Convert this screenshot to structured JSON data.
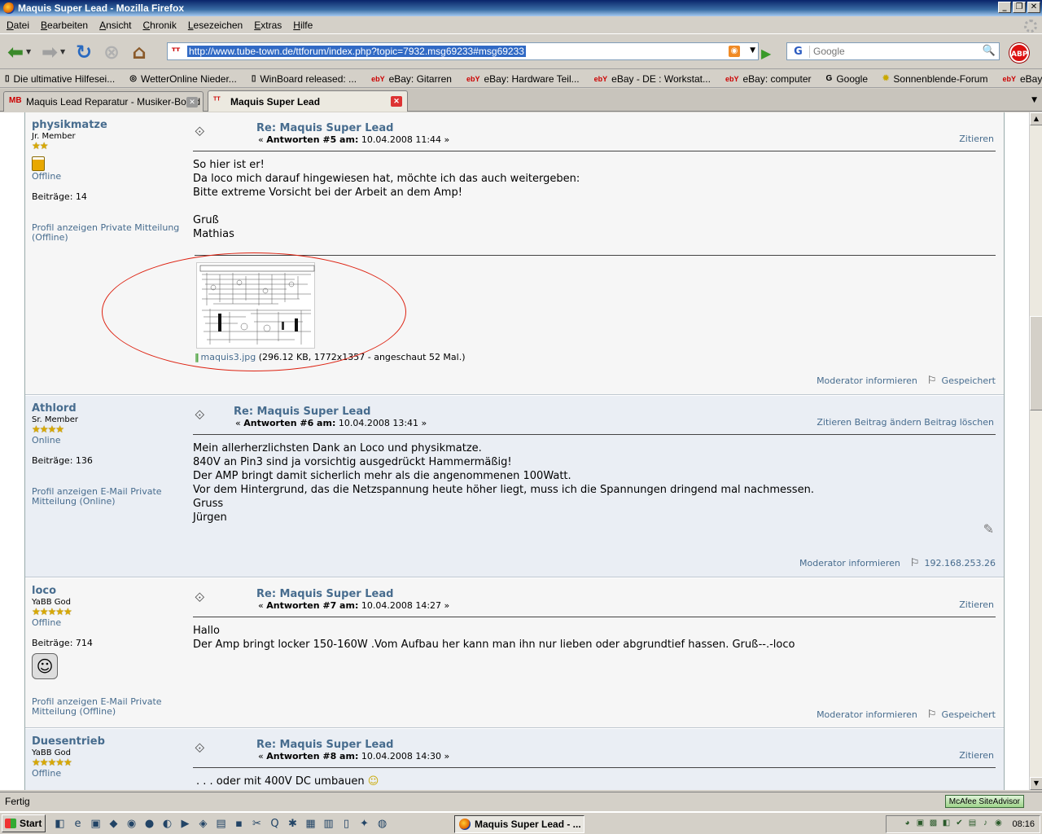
{
  "window": {
    "title": "Maquis Super Lead - Mozilla Firefox",
    "buttons": [
      "_",
      "❐",
      "✕"
    ]
  },
  "menu": [
    "Datei",
    "Bearbeiten",
    "Ansicht",
    "Chronik",
    "Lesezeichen",
    "Extras",
    "Hilfe"
  ],
  "nav": {
    "url": "http://www.tube-town.de/ttforum/index.php?topic=7932.msg69233#msg69233",
    "search_placeholder": "Google",
    "search_engine": "G",
    "abp": "ABP"
  },
  "bookmarks": [
    {
      "label": "Die ultimative Hilfesei...",
      "icon": "page-icon"
    },
    {
      "label": "WetterOnline Nieder...",
      "icon": "globe-icon"
    },
    {
      "label": "WinBoard released: ...",
      "icon": "page-icon"
    },
    {
      "label": "eBay: Gitarren",
      "icon": "ebay-icon"
    },
    {
      "label": "eBay: Hardware Teil...",
      "icon": "ebay-icon"
    },
    {
      "label": "eBay - DE : Workstat...",
      "icon": "ebay-icon"
    },
    {
      "label": "eBay: computer",
      "icon": "ebay-icon"
    },
    {
      "label": "Google",
      "icon": "google-icon"
    },
    {
      "label": "Sonnenblende-Forum",
      "icon": "sun-icon"
    },
    {
      "label": "eBay – Electric guitar...",
      "icon": "ebay-icon"
    }
  ],
  "tabs": [
    {
      "label": "Maquis Lead Reparatur - Musiker-Board",
      "close": "✕"
    },
    {
      "label": "Maquis Super Lead",
      "close": "✕"
    }
  ],
  "posts": [
    {
      "user": "physikmatze",
      "rank": "Jr. Member",
      "stars": "★★",
      "status": "Offline",
      "count": "Beiträge: 14",
      "links": "Profil anzeigen Private Mitteilung (Offline)",
      "title": "Re: Maquis Super Lead",
      "meta_prefix": "« ",
      "meta_bold": "Antworten #5 am:",
      "meta_date": " 10.04.2008 11:44 »",
      "actions": "Zitieren",
      "body": [
        "So hier ist er!",
        "Da loco mich darauf hingewiesen hat, möchte ich das auch weitergeben:",
        "Bitte extreme Vorsicht bei der Arbeit an dem Amp!",
        "",
        "Gruß",
        "Mathias"
      ],
      "attachment_name": "maquis3.jpg",
      "attachment_info": " (296.12 KB, 1772x1357 - angeschaut 52 Mal.)",
      "footer_left": "Moderator informieren",
      "footer_right": "Gespeichert"
    },
    {
      "user": "Athlord",
      "rank": "Sr. Member",
      "stars": "★★★★",
      "status": "Online",
      "count": "Beiträge: 136",
      "links": "Profil anzeigen E-Mail Private Mitteilung (Online)",
      "title": "Re: Maquis Super Lead",
      "meta_prefix": "« ",
      "meta_bold": "Antworten #6 am:",
      "meta_date": " 10.04.2008 13:41 »",
      "actions": "Zitieren Beitrag ändern Beitrag löschen",
      "body": [
        "Mein allerherzlichsten Dank an Loco und physikmatze.",
        "840V an Pin3 sind ja vorsichtig ausgedrückt Hammermäßig!",
        "Der AMP bringt damit sicherlich mehr als die angenommenen 100Watt.",
        "Vor dem Hintergrund, das die Netzspannung heute höher liegt, muss ich die Spannungen dringend mal nachmessen.",
        "Gruss",
        "Jürgen"
      ],
      "footer_left": "Moderator informieren",
      "footer_right": "192.168.253.26"
    },
    {
      "user": "loco",
      "rank": "YaBB God",
      "stars": "★★★★★",
      "status": "Offline",
      "count": "Beiträge: 714",
      "links": "Profil anzeigen E-Mail Private Mitteilung (Offline)",
      "title": "Re: Maquis Super Lead",
      "meta_prefix": "« ",
      "meta_bold": "Antworten #7 am:",
      "meta_date": " 10.04.2008 14:27 »",
      "actions": "Zitieren",
      "body": [
        "Hallo",
        "Der Amp bringt locker 150-160W .Vom Aufbau her kann man ihn nur lieben oder abgrundtief hassen. Gruß--.-loco"
      ],
      "footer_left": "Moderator informieren",
      "footer_right": "Gespeichert"
    },
    {
      "user": "Duesentrieb",
      "rank": "YaBB God",
      "stars": "★★★★★",
      "status": "Offline",
      "title": "Re: Maquis Super Lead",
      "meta_prefix": "« ",
      "meta_bold": "Antworten #8 am:",
      "meta_date": " 10.04.2008 14:30 »",
      "actions": "Zitieren",
      "body": [
        ". . . oder mit 400V DC umbauen"
      ]
    }
  ],
  "statusbar": {
    "text": "Fertig",
    "mcafee": "McAfee SiteAdvisor"
  },
  "taskbar": {
    "start": "Start",
    "task": "Maquis Super Lead - ...",
    "clock": "08:16"
  }
}
